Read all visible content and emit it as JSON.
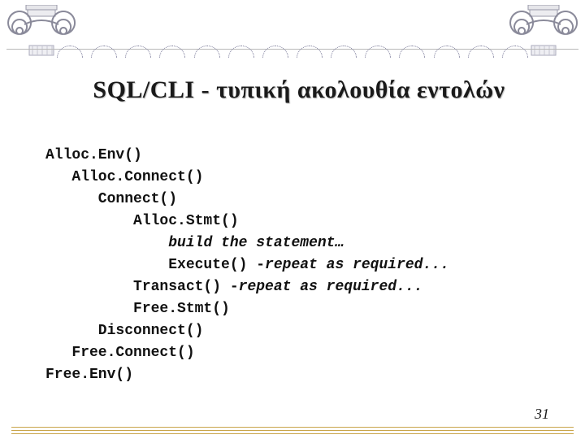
{
  "title": "SQL/CLI - τυπική ακολουθία εντολών",
  "lines": {
    "l0": "Alloc.Env()",
    "l1": "   Alloc.Connect()",
    "l2": "      Connect()",
    "l3": "          Alloc.Stmt()",
    "l4_pre": "              ",
    "l4_em": "build the statement…",
    "l5_pre": "              Execute() -",
    "l5_em": "repeat as required...",
    "l6_pre": "          Transact() -",
    "l6_em": "repeat as required...",
    "l7": "          Free.Stmt()",
    "l8": "      Disconnect()",
    "l9": "   Free.Connect()",
    "l10": "Free.Env()"
  },
  "page_number": "31"
}
